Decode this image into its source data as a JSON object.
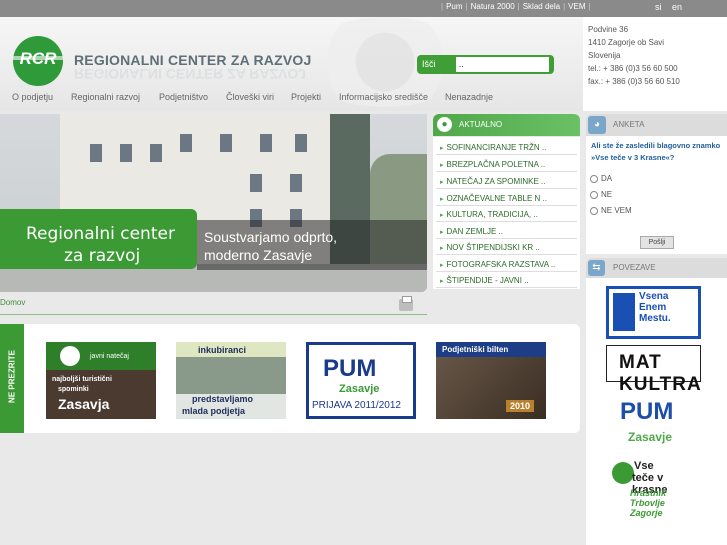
{
  "topbar": {
    "links": [
      "Pum",
      "Natura 2000",
      "Sklad dela",
      "VEM"
    ],
    "languages": [
      "si",
      "en"
    ]
  },
  "header": {
    "logo_text": "RCR",
    "title": "REGIONALNI CENTER ZA RAZVOJ",
    "search": {
      "label": "Išči",
      "value": ".."
    }
  },
  "address": {
    "lines": [
      "Podvine 36",
      "1410 Zagorje ob Savi",
      "Slovenija",
      "tel.: + 386 (0)3 56 60 500",
      "fax.: + 386 (0)3 56 60 510"
    ]
  },
  "nav": {
    "items": [
      "O podjetju",
      "Regionalni razvoj",
      "Podjetništvo",
      "Človeški viri",
      "Projekti",
      "Informacijsko središče",
      "Nenazadnje"
    ]
  },
  "banner": {
    "line1": "Regionalni center",
    "line2": "za razvoj",
    "slogan1": "Soustvarjamo odprto,",
    "slogan2": "moderno Zasavje"
  },
  "breadcrumb": "Domov",
  "news": {
    "title": "AKTUALNO",
    "items": [
      "SOFINANCIRANJE TRŽN ..",
      "BREZPLAČNA POLETNA ..",
      "NATEČAJ ZA SPOMINKE ..",
      "OZNAČEVALNE TABLE N ..",
      "KULTURA, TRADICIJA, ..",
      "DAN ZEMLJE ..",
      "NOV ŠTIPENDIJSKI KR ..",
      "FOTOGRAFSKA RAZSTAVA ..",
      "ŠTIPENDIJE - JAVNI .."
    ]
  },
  "poll": {
    "title": "ANKETA",
    "question": "Ali ste že zasledili blagovno znamko »Vse teče v 3 Krasne«?",
    "options": [
      "DA",
      "NE",
      "NE VEM"
    ],
    "button": "Pošlji"
  },
  "links": {
    "title": "POVEZAVE",
    "vem": [
      "Vsena",
      "Enem",
      "Mestu."
    ],
    "matkultura": "MAT KULTRA",
    "pum": "PUM",
    "pum_sub": "Zasavje",
    "vsetece1": "Vse",
    "vsetece2": "teče v krasne",
    "vsetece_sub": [
      "Hrastnik",
      "Trbovlje",
      "Zagorje"
    ]
  },
  "promo": {
    "tab": "NE PREZRITE",
    "card1": {
      "t1": "javni natečaj",
      "t2": "najboljši turistični",
      "t3": "spominki",
      "t4": "Zasavja"
    },
    "card2": {
      "t1": "inkubiranci",
      "t2": "predstavljamo",
      "t3": "mlada podjetja"
    },
    "card3": {
      "t1": "PUM",
      "t2": "Zasavje",
      "t3": "PRIJAVA 2011/2012"
    },
    "card4": {
      "t1": "Podjetniški bilten",
      "t2": "2010"
    }
  }
}
